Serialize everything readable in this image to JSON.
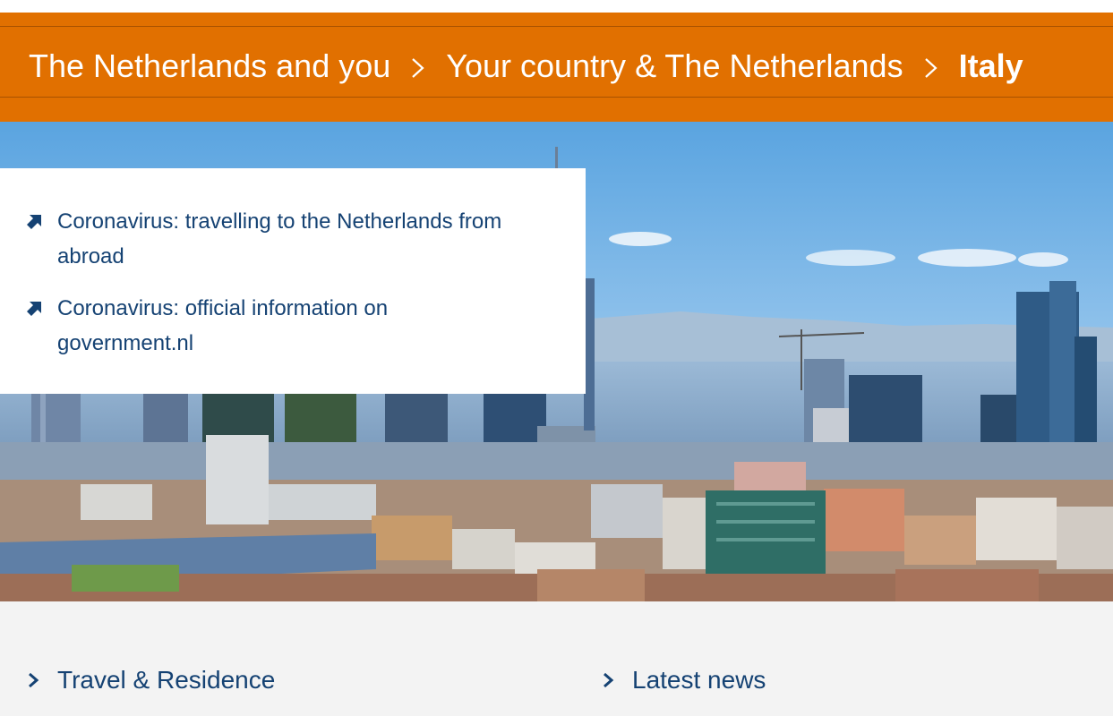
{
  "breadcrumb": {
    "items": [
      {
        "label": "The Netherlands and you"
      },
      {
        "label": "Your country & The Netherlands"
      },
      {
        "label": "Italy"
      }
    ]
  },
  "notices": [
    {
      "label": "Coronavirus: travelling to the Netherlands from abroad",
      "icon": "external-arrow-icon"
    },
    {
      "label": "Coronavirus: official information on government.nl",
      "icon": "external-arrow-icon"
    }
  ],
  "sections": [
    {
      "label": "Travel & Residence",
      "icon": "chevron-right-icon"
    },
    {
      "label": "Latest news",
      "icon": "chevron-right-icon"
    }
  ],
  "colors": {
    "brand_orange": "#e17000",
    "link_blue": "#154273",
    "background": "#f3f3f3"
  }
}
